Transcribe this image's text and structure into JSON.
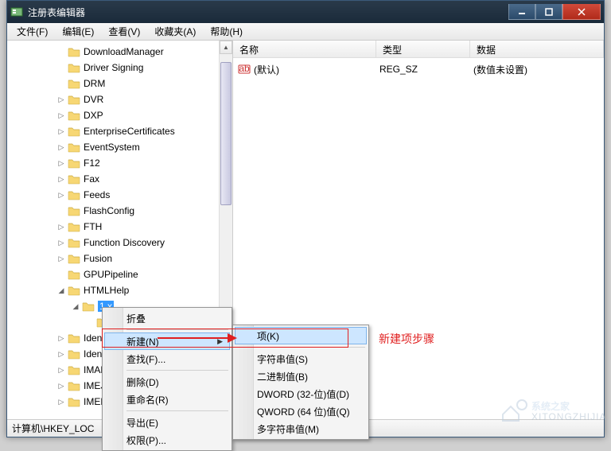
{
  "window": {
    "title": "注册表编辑器"
  },
  "menu": {
    "file": "文件(F)",
    "edit": "编辑(E)",
    "view": "查看(V)",
    "favorites": "收藏夹(A)",
    "help": "帮助(H)"
  },
  "tree": {
    "items": [
      {
        "indent": 3,
        "exp": "",
        "label": "DownloadManager"
      },
      {
        "indent": 3,
        "exp": "",
        "label": "Driver Signing"
      },
      {
        "indent": 3,
        "exp": "",
        "label": "DRM"
      },
      {
        "indent": 3,
        "exp": "▷",
        "label": "DVR"
      },
      {
        "indent": 3,
        "exp": "▷",
        "label": "DXP"
      },
      {
        "indent": 3,
        "exp": "▷",
        "label": "EnterpriseCertificates"
      },
      {
        "indent": 3,
        "exp": "▷",
        "label": "EventSystem"
      },
      {
        "indent": 3,
        "exp": "▷",
        "label": "F12"
      },
      {
        "indent": 3,
        "exp": "▷",
        "label": "Fax"
      },
      {
        "indent": 3,
        "exp": "▷",
        "label": "Feeds"
      },
      {
        "indent": 3,
        "exp": "",
        "label": "FlashConfig"
      },
      {
        "indent": 3,
        "exp": "▷",
        "label": "FTH"
      },
      {
        "indent": 3,
        "exp": "▷",
        "label": "Function Discovery"
      },
      {
        "indent": 3,
        "exp": "▷",
        "label": "Fusion"
      },
      {
        "indent": 3,
        "exp": "",
        "label": "GPUPipeline"
      },
      {
        "indent": 3,
        "exp": "◢",
        "label": "HTMLHelp"
      },
      {
        "indent": 4,
        "exp": "◢",
        "label": "1.x",
        "selected": true
      },
      {
        "indent": 5,
        "exp": "",
        "label": ""
      },
      {
        "indent": 3,
        "exp": "▷",
        "label": "Ident"
      },
      {
        "indent": 3,
        "exp": "▷",
        "label": "Ident"
      },
      {
        "indent": 3,
        "exp": "▷",
        "label": "IMAP"
      },
      {
        "indent": 3,
        "exp": "▷",
        "label": "IMEJF"
      },
      {
        "indent": 3,
        "exp": "▷",
        "label": "IMEK"
      }
    ]
  },
  "list": {
    "columns": {
      "name": "名称",
      "type": "类型",
      "data": "数据"
    },
    "col_widths": {
      "name": 180,
      "type": 118,
      "data": 150
    },
    "rows": [
      {
        "name": "(默认)",
        "type": "REG_SZ",
        "data": "(数值未设置)"
      }
    ]
  },
  "statusbar": {
    "path": "计算机\\HKEY_LOC"
  },
  "context1": {
    "items": [
      {
        "label": "折叠",
        "enabled": true
      },
      {
        "sep": true
      },
      {
        "label": "新建(N)",
        "enabled": true,
        "sub": true,
        "hover": true
      },
      {
        "label": "查找(F)...",
        "enabled": true
      },
      {
        "sep": true
      },
      {
        "label": "删除(D)",
        "enabled": true
      },
      {
        "label": "重命名(R)",
        "enabled": true
      },
      {
        "sep": true
      },
      {
        "label": "导出(E)",
        "enabled": true
      },
      {
        "label": "权限(P)...",
        "enabled": true
      }
    ]
  },
  "context2": {
    "items": [
      {
        "label": "项(K)",
        "hover": true
      },
      {
        "sep": true
      },
      {
        "label": "字符串值(S)"
      },
      {
        "label": "二进制值(B)"
      },
      {
        "label": "DWORD (32-位)值(D)"
      },
      {
        "label": "QWORD (64 位)值(Q)"
      },
      {
        "label": "多字符串值(M)"
      }
    ]
  },
  "annotation": {
    "text": "新建项步骤"
  },
  "watermark": {
    "text": "系统之家",
    "url": "XITONGZHIJIA.NET"
  }
}
